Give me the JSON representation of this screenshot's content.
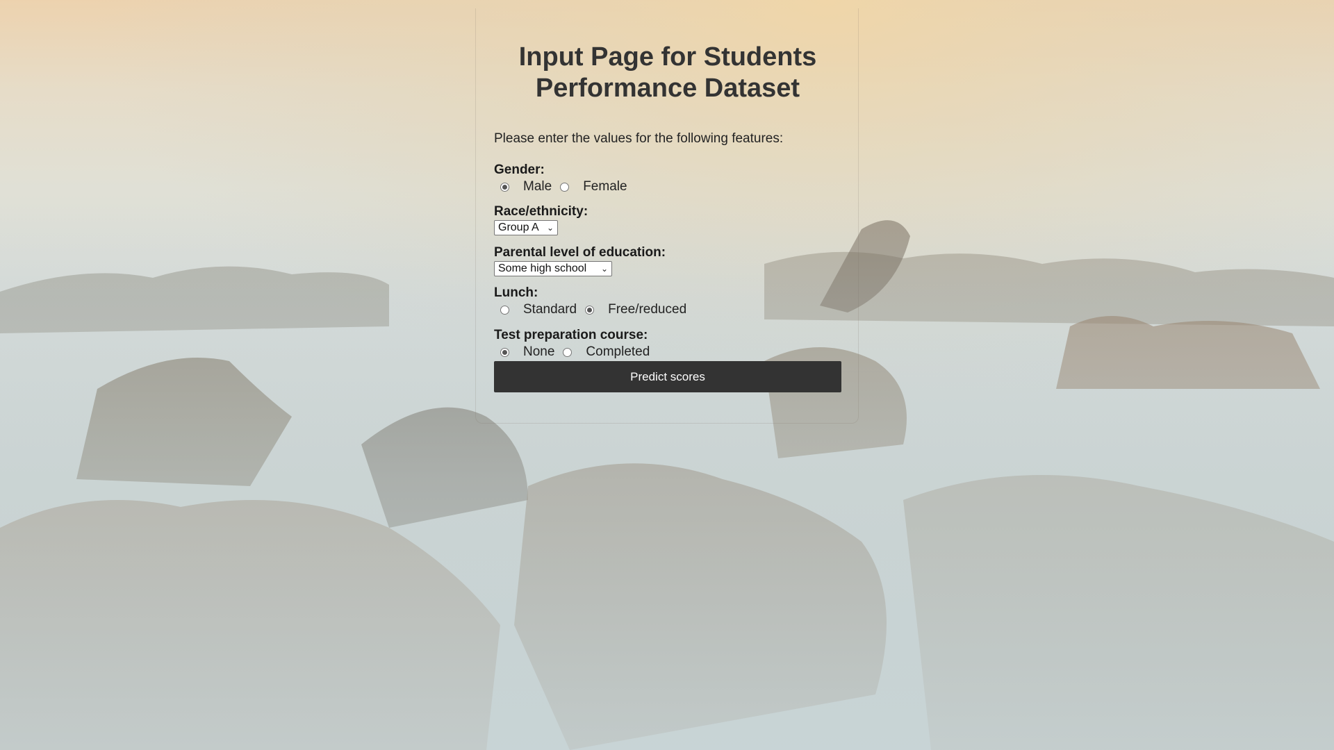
{
  "page": {
    "title": "Input Page for Students Performance Dataset",
    "intro": "Please enter the values for the following features:"
  },
  "form": {
    "gender": {
      "label": "Gender:",
      "options": [
        "Male",
        "Female"
      ],
      "selected": "Male"
    },
    "race": {
      "label": "Race/ethnicity:",
      "value": "Group A"
    },
    "parental_education": {
      "label": "Parental level of education:",
      "value": "Some high school"
    },
    "lunch": {
      "label": "Lunch:",
      "options": [
        "Standard",
        "Free/reduced"
      ],
      "selected": "Free/reduced"
    },
    "test_prep": {
      "label": "Test preparation course:",
      "options": [
        "None",
        "Completed"
      ],
      "selected": "None"
    },
    "submit_label": "Predict scores"
  },
  "colors": {
    "button_bg": "#333333",
    "heading": "#333333"
  }
}
